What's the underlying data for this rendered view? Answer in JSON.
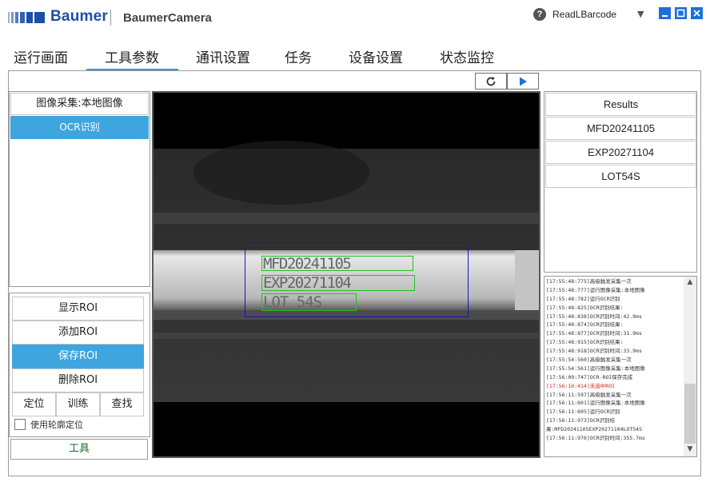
{
  "header": {
    "brand": "Baumer",
    "app_title": "BaumerCamera",
    "program": "ReadLBarcode",
    "colors": {
      "brand": "#1e4fa8",
      "window_buttons": "#1e6fd9"
    }
  },
  "tabs": [
    {
      "label": "运行画面"
    },
    {
      "label": "工具参数",
      "active": true
    },
    {
      "label": "通讯设置"
    },
    {
      "label": "任务"
    },
    {
      "label": "设备设置"
    },
    {
      "label": "状态监控"
    }
  ],
  "toolbar": {
    "refresh_icon": "refresh-icon",
    "run_icon": "play-icon"
  },
  "left_panel": {
    "header": "图像采集:本地图像",
    "selected_item": "OCR识别",
    "buttons": {
      "show_roi": "显示ROI",
      "add_roi": "添加ROI",
      "save_roi": "保存ROI",
      "delete_roi": "删除ROI"
    },
    "small_buttons": {
      "locate": "定位",
      "train": "训练",
      "find": "查找"
    },
    "checkbox_label": "使用轮廓定位",
    "tool_tab": "工具",
    "colors": {
      "selected": "#3ea5de",
      "tool_tab_text": "#1e6b2b"
    }
  },
  "viewer": {
    "ocr_lines": [
      "MFD20241105",
      "EXP20271104",
      "LOT 54S"
    ],
    "colors": {
      "roi_box": "#1515c8",
      "ocr_box": "#22c322"
    }
  },
  "results": {
    "header": "Results",
    "items": [
      "MFD20241105",
      "EXP20271104",
      "LOT54S"
    ]
  },
  "log": {
    "lines": [
      {
        "text": "[17:55:48:775]高级触发采集一次"
      },
      {
        "text": "[17:55:48:777]运行图像采集:本地图像"
      },
      {
        "text": "[17:55:48:782]运行OCR识别"
      },
      {
        "text": "[17:55:48:825]OCR识别结果:"
      },
      {
        "text": "[17:55:48:838]OCR识别时间:42.9ms"
      },
      {
        "text": "[17:55:48:874]OCR识别结果:"
      },
      {
        "text": "[17:55:48:877]OCR识别时间:31.9ms"
      },
      {
        "text": "[17:55:48:915]OCR识别结果:"
      },
      {
        "text": "[17:55:48:918]OCR识别时间:33.9ms"
      },
      {
        "text": "[17:55:54:560]高级触发采集一次"
      },
      {
        "text": "[17:55:54:561]运行图像采集:本地图像"
      },
      {
        "text": "[17:56:09:747]OCR-ROI保存完成"
      },
      {
        "text": "[17:56:10:414]未选中ROI",
        "error": true
      },
      {
        "text": "[17:56:11:597]高级触发采集一次"
      },
      {
        "text": "[17:56:11:601]运行图像采集:本地图像"
      },
      {
        "text": "[17:56:11:605]运行OCR识别"
      },
      {
        "text": "[17:56:11:973]OCR识别结"
      },
      {
        "text": "果:MFD20241105EXP20271104LOT54S"
      },
      {
        "text": "[17:56:11:976]OCR识别时间:355.7ms"
      }
    ],
    "colors": {
      "error": "#d62020"
    }
  }
}
